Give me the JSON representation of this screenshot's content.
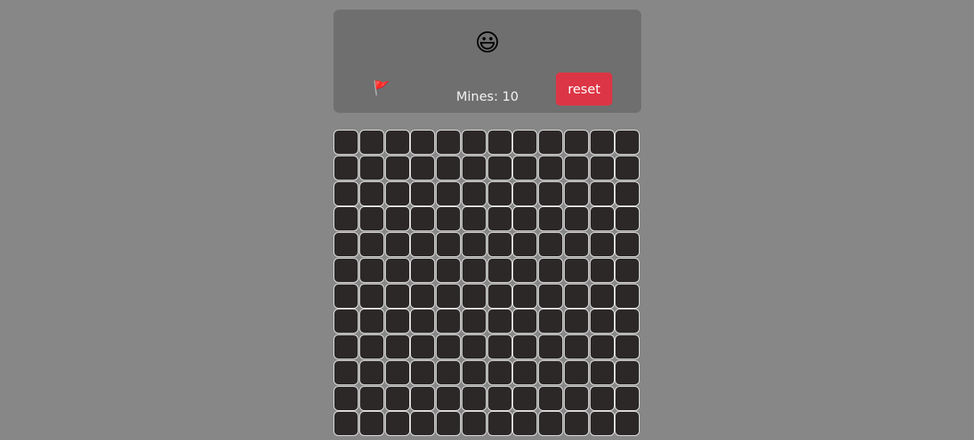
{
  "header": {
    "face_icon": "smiley-face-icon",
    "face_glyph": "😃",
    "flag_icon": "flag-icon",
    "flag_glyph": "🚩",
    "mines_label": "Mines: 10",
    "reset_label": "reset"
  },
  "board": {
    "rows": 12,
    "columns": 12,
    "cell_state": "hidden"
  },
  "colors": {
    "background": "#878787",
    "panel": "#6f6f6f",
    "cell": "#2d2828",
    "reset_button": "#dc3545"
  }
}
